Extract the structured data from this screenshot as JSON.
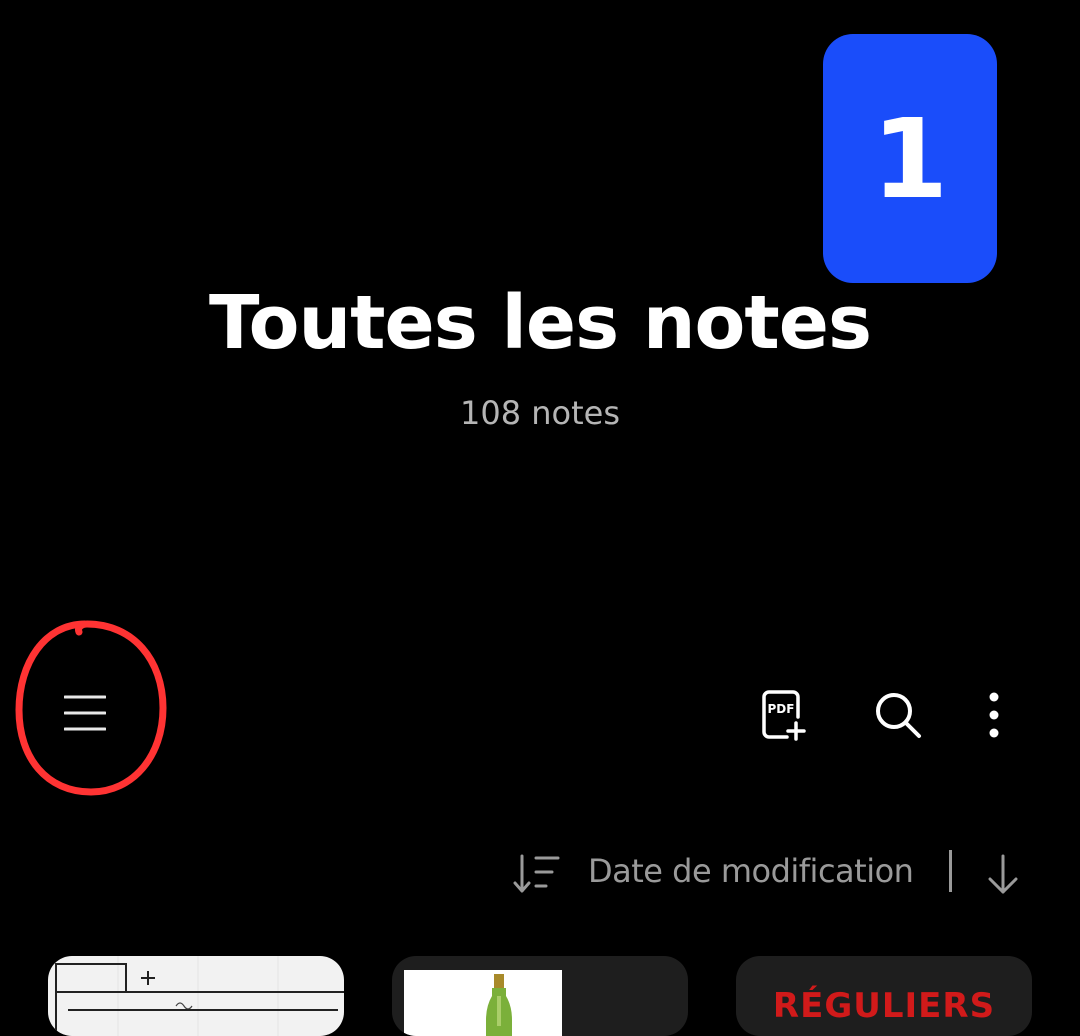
{
  "step_badge": {
    "number": "1",
    "color": "#1a4dfa"
  },
  "header": {
    "title": "Toutes les notes",
    "count": "108 notes"
  },
  "toolbar": {
    "menu_icon": "hamburger-menu-icon",
    "pdf_icon": "pdf-add-icon",
    "pdf_icon_label": "PDF",
    "search_icon": "search-icon",
    "more_icon": "more-vertical-icon"
  },
  "highlight": {
    "color": "#ff3333"
  },
  "sort": {
    "label": "Date de modification",
    "direction": "descending"
  },
  "notes": [
    {
      "type": "handwritten-table"
    },
    {
      "type": "image",
      "image": "bottle-icon"
    },
    {
      "type": "text",
      "heading": "RÉGULIERS"
    }
  ]
}
